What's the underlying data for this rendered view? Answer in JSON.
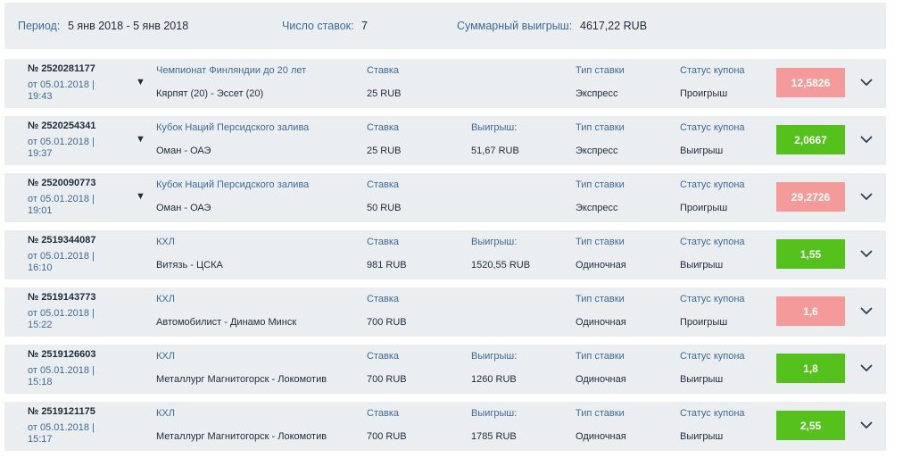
{
  "summary": {
    "period_label": "Период:",
    "period_value": "5 янв 2018 - 5 янв 2018",
    "count_label": "Число ставок:",
    "count_value": "7",
    "total_label": "Суммарный выигрыш:",
    "total_value": "4617,22 RUB"
  },
  "labels": {
    "stake": "Ставка",
    "win": "Выигрыш:",
    "type": "Тип ставки",
    "status": "Статус купона"
  },
  "colors": {
    "lost": "#f59a9a",
    "won": "#55c11c",
    "label": "#3d6a96",
    "row_bg": "#ebeef1"
  },
  "bets": [
    {
      "number": "№ 2520281177",
      "date": "от 05.01.2018 | 19:43",
      "has_toggle": true,
      "toggle": "▼",
      "championship": "Чемпионат Финляндии до 20 лет",
      "match": "Кярпят (20) - Эссет (20)",
      "stake": "25 RUB",
      "win": "",
      "type": "Экспресс",
      "status": "Проигрыш",
      "coef": "12,5826",
      "result": "lost"
    },
    {
      "number": "№ 2520254341",
      "date": "от 05.01.2018 | 19:37",
      "has_toggle": true,
      "toggle": "▼",
      "championship": "Кубок Наций Персидского залива",
      "match": "Оман - ОАЭ",
      "stake": "25 RUB",
      "win": "51,67 RUB",
      "type": "Экспресс",
      "status": "Выигрыш",
      "coef": "2,0667",
      "result": "won"
    },
    {
      "number": "№ 2520090773",
      "date": "от 05.01.2018 | 19:01",
      "has_toggle": true,
      "toggle": "▼",
      "championship": "Кубок Наций Персидского залива",
      "match": "Оман - ОАЭ",
      "stake": "50 RUB",
      "win": "",
      "type": "Экспресс",
      "status": "Проигрыш",
      "coef": "29,2726",
      "result": "lost"
    },
    {
      "number": "№ 2519344087",
      "date": "от 05.01.2018 | 16:10",
      "has_toggle": false,
      "toggle": "",
      "championship": "КХЛ",
      "match": "Витязь - ЦСКА",
      "stake": "981 RUB",
      "win": "1520,55 RUB",
      "type": "Одиночная",
      "status": "Выигрыш",
      "coef": "1,55",
      "result": "won"
    },
    {
      "number": "№ 2519143773",
      "date": "от 05.01.2018 | 15:22",
      "has_toggle": false,
      "toggle": "",
      "championship": "КХЛ",
      "match": "Автомобилист - Динамо Минск",
      "stake": "700 RUB",
      "win": "",
      "type": "Одиночная",
      "status": "Проигрыш",
      "coef": "1,6",
      "result": "lost"
    },
    {
      "number": "№ 2519126603",
      "date": "от 05.01.2018 | 15:18",
      "has_toggle": false,
      "toggle": "",
      "championship": "КХЛ",
      "match": "Металлург Магнитогорск - Локомотив",
      "stake": "700 RUB",
      "win": "1260 RUB",
      "type": "Одиночная",
      "status": "Выигрыш",
      "coef": "1,8",
      "result": "won"
    },
    {
      "number": "№ 2519121175",
      "date": "от 05.01.2018 | 15:17",
      "has_toggle": false,
      "toggle": "",
      "championship": "КХЛ",
      "match": "Металлург Магнитогорск - Локомотив",
      "stake": "700 RUB",
      "win": "1785 RUB",
      "type": "Одиночная",
      "status": "Выигрыш",
      "coef": "2,55",
      "result": "won"
    }
  ]
}
